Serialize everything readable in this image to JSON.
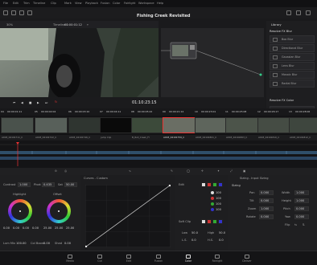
{
  "menu": [
    "File",
    "Edit",
    "Trim",
    "Timeline",
    "Clip",
    "Mark",
    "View",
    "Playback",
    "Fusion",
    "Color",
    "Fairlight",
    "Workspace",
    "Help"
  ],
  "project_title": "Fishing Creek Revisited",
  "viewer": {
    "timeline_name": "Timeline 1",
    "source_tc": "00:00:01:12",
    "clip_label": "Clip",
    "zoom": "30%"
  },
  "panel": {
    "tab": "Library",
    "sections": [
      {
        "title": "Resolve FX Blur",
        "items": [
          "Box Blur",
          "Directional Blur",
          "Gaussian Blur",
          "Lens Blur",
          "Mosaic Blur",
          "Radial Blur"
        ]
      },
      {
        "title": "Resolve FX Color",
        "items": [
          "ACES Transform",
          "Color Compressor"
        ]
      }
    ]
  },
  "transport": {
    "timecode": "01:10:23:15"
  },
  "clips": [
    {
      "num": "04",
      "tc": "00:00:01:11",
      "track": "V1",
      "name": "A003_04191711_C"
    },
    {
      "num": "05",
      "tc": "00:00:02:04",
      "track": "V1",
      "name": "A003_04191722_C"
    },
    {
      "num": "06",
      "tc": "00:00:03:10",
      "track": "V1",
      "name": "A003_04191746_C"
    },
    {
      "num": "07",
      "tc": "00:00:04:11",
      "track": "V1",
      "name": "Jump Clip"
    },
    {
      "num": "08",
      "tc": "00:00:05:22",
      "track": "V1",
      "name": "B_Roll_Creek_Fl"
    },
    {
      "num": "09",
      "tc": "00:00:21:14",
      "track": "V1",
      "name": "A003_04191759_C"
    },
    {
      "num": "10",
      "tc": "00:00:23:01",
      "track": "V1",
      "name": "A003_04191801_C"
    },
    {
      "num": "11",
      "tc": "00:00:25:08",
      "track": "V1",
      "name": "A003_04191803_C"
    },
    {
      "num": "12",
      "tc": "00:00:26:17",
      "track": "V1",
      "name": "A003_04191810_C"
    },
    {
      "num": "13",
      "tc": "00:00:28:06",
      "track": "V1",
      "name": "A003_04191812_C"
    }
  ],
  "primaries": {
    "contrast_label": "Contrast",
    "contrast": "1.000",
    "pivot_label": "Pivot",
    "pivot": "0.435",
    "sat_label": "Sat",
    "sat": "50.00",
    "wheel1": {
      "name": "Highlight",
      "values": [
        "0.00",
        "0.00",
        "0.00",
        "0.00"
      ]
    },
    "wheel2": {
      "name": "Offset",
      "values": [
        "25.00",
        "25.00",
        "25.00"
      ]
    },
    "bottom_labels": [
      "Lum Mix",
      "100.00",
      "Col Boost",
      "0.00",
      "Shad",
      "0.00"
    ]
  },
  "curves": {
    "title": "Curves - Custom",
    "edit_label": "Edit",
    "values": [
      "100",
      "100",
      "100",
      "100"
    ],
    "soft_clip_label": "Soft Clip",
    "sc": {
      "low": "50.0",
      "high": "50.0",
      "ls": "0.0",
      "hs": "0.0"
    }
  },
  "sizing": {
    "title": "Sizing - Input Sizing",
    "group": "Sizing",
    "rows": [
      {
        "l": "Pan",
        "v": "0.000",
        "l2": "Width",
        "v2": "1.000"
      },
      {
        "l": "Tilt",
        "v": "0.000",
        "l2": "Height",
        "v2": "1.000"
      },
      {
        "l": "Zoom",
        "v": "1.000",
        "l2": "Pitch",
        "v2": "0.000"
      },
      {
        "l": "Rotate",
        "v": "0.000",
        "l2": "Yaw",
        "v2": "0.000"
      },
      {
        "l": "",
        "v": "",
        "l2": "Flip",
        "v2": ""
      }
    ]
  },
  "pages": [
    "Media",
    "Cut",
    "Edit",
    "Fusion",
    "Color",
    "Fairlight",
    "Deliver"
  ],
  "active_page": "Color"
}
